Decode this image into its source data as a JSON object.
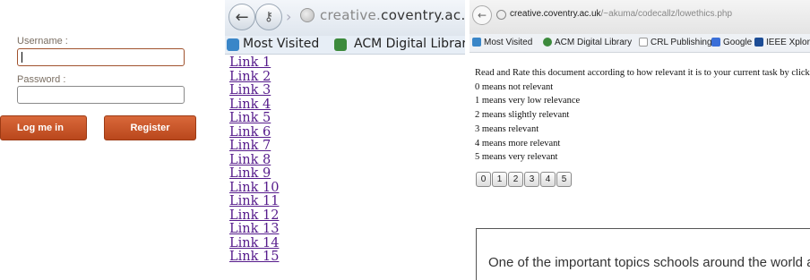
{
  "login": {
    "username_label": "Username :",
    "password_label": "Password :",
    "username_value": "",
    "password_value": "",
    "login_button": "Log me in",
    "register_button": "Register",
    "accent_color": "#c4562a"
  },
  "links_window": {
    "address": {
      "prefix": "creative.",
      "domain": "coventry.ac.uk"
    },
    "bookmarks": [
      "Most Visited",
      "ACM Digital Librar"
    ],
    "links": [
      "Link 1",
      "Link 2",
      "Link 3",
      "Link 4",
      "Link 5",
      "Link 6",
      "Link 7",
      "Link 8",
      "Link 9",
      "Link 10",
      "Link 11",
      "Link 12",
      "Link 13",
      "Link 14",
      "Link 15"
    ],
    "link_color": "#551a8b"
  },
  "rating_window": {
    "address": {
      "domain": "creative.coventry.ac.uk",
      "path": "/~akuma/codecallz/lowethics.php"
    },
    "bookmarks": [
      "Most Visited",
      "ACM Digital Library",
      "CRL Publishing",
      "Google",
      "IEEE Xplore - Home"
    ],
    "instructions": [
      "Read and Rate this document according to how relevant it is to your current task by clicki",
      "0 means not relevant",
      "1 means very low relevance",
      "2 means slightly relevant",
      "3 means relevant",
      "4 means more relevant",
      "5 means very relevant"
    ],
    "rating_buttons": [
      "0",
      "1",
      "2",
      "3",
      "4",
      "5"
    ],
    "document_text": "One of the important topics schools around the world are"
  }
}
